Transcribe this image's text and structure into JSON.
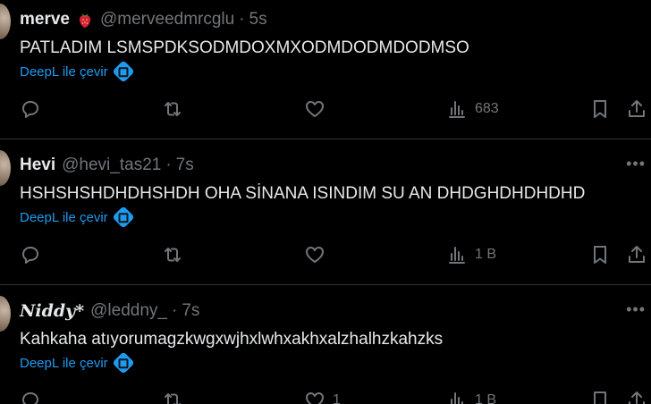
{
  "tweets": [
    {
      "name": "merve",
      "handle": "@merveedmrcglu",
      "separator": "·",
      "time": "5s",
      "text": "PATLADIM LSMSPDKSODMDOXMXODMDODMDODMSO",
      "translate_label": "DeepL ile çevir",
      "replies": "",
      "reposts": "",
      "likes": "",
      "views": "683",
      "has_emoji": true
    },
    {
      "name": "Hevi",
      "handle": "@hevi_tas21",
      "separator": "·",
      "time": "7s",
      "text": "HSHSHSHDHDHSHDH OHA SİNANA ISINDIM SU AN DHDGHDHDHDHD",
      "translate_label": "DeepL ile çevir",
      "replies": "",
      "reposts": "",
      "likes": "",
      "views": "1 B"
    },
    {
      "name": "Niddy*",
      "handle": "@leddny_",
      "separator": "·",
      "time": "7s",
      "text": "Kahkaha atıyorumagzkwgxwjhxlwhxakhxalzhalhzkahzks",
      "translate_label": "DeepL ile çevir",
      "replies": "",
      "reposts": "",
      "likes": "1",
      "views": "1 B"
    }
  ],
  "icons": {
    "emoji": "strawberry-emoji",
    "reply": "reply-icon",
    "repost": "repost-icon",
    "like": "like-icon",
    "views": "views-icon",
    "bookmark": "bookmark-icon",
    "share": "share-icon",
    "more": "more-icon",
    "translate": "deepl-icon"
  },
  "colors": {
    "background": "#000000",
    "text": "#e7e9ea",
    "muted": "#71767b",
    "link": "#1d9bf0",
    "divider": "#2f3336"
  }
}
